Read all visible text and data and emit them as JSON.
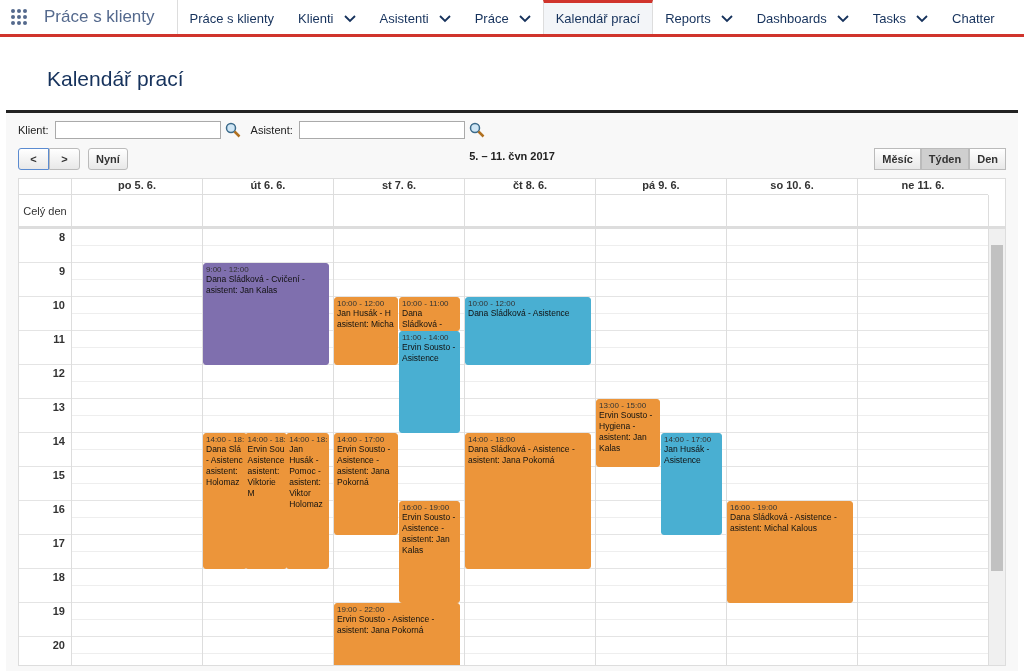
{
  "nav": {
    "app_name": "Práce s klienty",
    "tabs": [
      {
        "label": "Práce s klienty",
        "dropdown": false,
        "selected": false
      },
      {
        "label": "Klienti",
        "dropdown": true,
        "selected": false
      },
      {
        "label": "Asistenti",
        "dropdown": true,
        "selected": false
      },
      {
        "label": "Práce",
        "dropdown": true,
        "selected": false
      },
      {
        "label": "Kalendář prací",
        "dropdown": false,
        "selected": true
      },
      {
        "label": "Reports",
        "dropdown": true,
        "selected": false
      },
      {
        "label": "Dashboards",
        "dropdown": true,
        "selected": false
      },
      {
        "label": "Tasks",
        "dropdown": true,
        "selected": false
      },
      {
        "label": "Chatter",
        "dropdown": false,
        "selected": false
      }
    ]
  },
  "page_title": "Kalendář prací",
  "filters": [
    {
      "label": "Klient:"
    },
    {
      "label": "Asistent:"
    }
  ],
  "toolbar": {
    "prev": "<",
    "next": ">",
    "today": "Nyní",
    "range": "5. – 11. čvn 2017",
    "views": [
      {
        "label": "Měsíc",
        "selected": false
      },
      {
        "label": "Týden",
        "selected": true
      },
      {
        "label": "Den",
        "selected": false
      }
    ]
  },
  "calendar": {
    "all_day_label": "Celý den",
    "hours": [
      "8",
      "9",
      "10",
      "11",
      "12",
      "13",
      "14",
      "15",
      "16",
      "17",
      "18",
      "19",
      "20"
    ],
    "days": [
      {
        "label": "po 5. 6."
      },
      {
        "label": "út 6. 6.",
        "events": [
          {
            "time": "9:00 - 12:00",
            "text": "Dana Sládková - Cvičení -\nasistent: Jan Kalas",
            "color": "#7f6fab"
          },
          {
            "time": "14:00 - 18:",
            "text": "Dana Slá\n- Asistenc\nasistent:\nHolomaz",
            "color": "#e8963f"
          },
          {
            "time": "14:00 - 18:",
            "text": "Ervin Sou\nAsistence\nasistent:\nViktorie M",
            "color": "#e8963f"
          },
          {
            "time": "14:00 - 18:",
            "text": "Jan\nHusák -\nPomoc -\nasistent:\nViktor\nHolomaz",
            "color": "#e8963f"
          }
        ]
      },
      {
        "label": "st 7. 6.",
        "events": [
          {
            "time": "10:00 - 12:00",
            "text": "Jan Husák - H\nasistent: Micha",
            "color": "#e8963f"
          },
          {
            "time": "10:00 - 11:00",
            "text": "Dana\nSládková -",
            "color": "#e8963f"
          },
          {
            "time": "11:00 - 14:00",
            "text": "Ervin Sousto -\nAsistence",
            "color": "#4daecf"
          },
          {
            "time": "14:00 - 17:00",
            "text": "Ervin Sousto - Asistence - asistent: Jana Pokorná",
            "color": "#e8963f"
          },
          {
            "time": "16:00 - 19:00",
            "text": "Ervin Sousto -\nAsistence -\nasistent: Jan\nKalas",
            "color": "#e8963f"
          },
          {
            "time": "19:00 - 22:00",
            "text": "Ervin Sousto - Asistence -\nasistent: Jana Pokorná",
            "color": "#e8963f"
          }
        ]
      },
      {
        "label": "čt 8. 6.",
        "events": [
          {
            "time": "10:00 - 12:00",
            "text": "Dana Sládková - Asistence",
            "color": "#4daecf"
          },
          {
            "time": "14:00 - 18:00",
            "text": "Dana Sládková - Asistence -\nasistent: Jana Pokorná",
            "color": "#e8963f"
          }
        ]
      },
      {
        "label": "pá 9. 6.",
        "events": [
          {
            "time": "13:00 - 15:00",
            "text": "Ervin Sousto - Hygiena - asistent: Jan Kalas",
            "color": "#e8963f"
          },
          {
            "time": "14:00 - 17:00",
            "text": "Jan Husák -\nAsistence",
            "color": "#4daecf"
          }
        ]
      },
      {
        "label": "so 10. 6.",
        "events": [
          {
            "time": "16:00 - 19:00",
            "text": "Dana Sládková - Asistence -\nasistent: Michal Kalous",
            "color": "#e8963f"
          }
        ]
      },
      {
        "label": "ne 11. 6."
      }
    ]
  }
}
